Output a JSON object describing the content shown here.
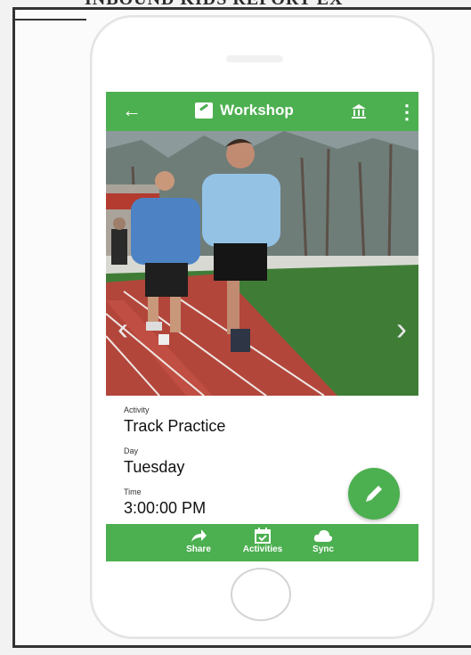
{
  "document": {
    "banner_text": "INBOUND KIDS REPORT EX"
  },
  "app": {
    "title": "Workshop",
    "icons": {
      "back": "arrow-left-icon",
      "title": "notepad-icon",
      "bank": "bank-icon",
      "more": "more-vertical-icon"
    }
  },
  "photo": {
    "subject": "two boys running on a track",
    "prev_label": "‹",
    "next_label": "›"
  },
  "details": [
    {
      "label": "Activity",
      "value": "Track Practice"
    },
    {
      "label": "Day",
      "value": "Tuesday"
    },
    {
      "label": "Time",
      "value": "3:00:00 PM"
    }
  ],
  "fab": {
    "icon": "pencil-icon"
  },
  "bottom_nav": [
    {
      "label": "Share",
      "icon": "share-icon"
    },
    {
      "label": "Activities",
      "icon": "calendar-check-icon"
    },
    {
      "label": "Sync",
      "icon": "cloud-icon"
    }
  ],
  "colors": {
    "accent": "#4caf50"
  }
}
